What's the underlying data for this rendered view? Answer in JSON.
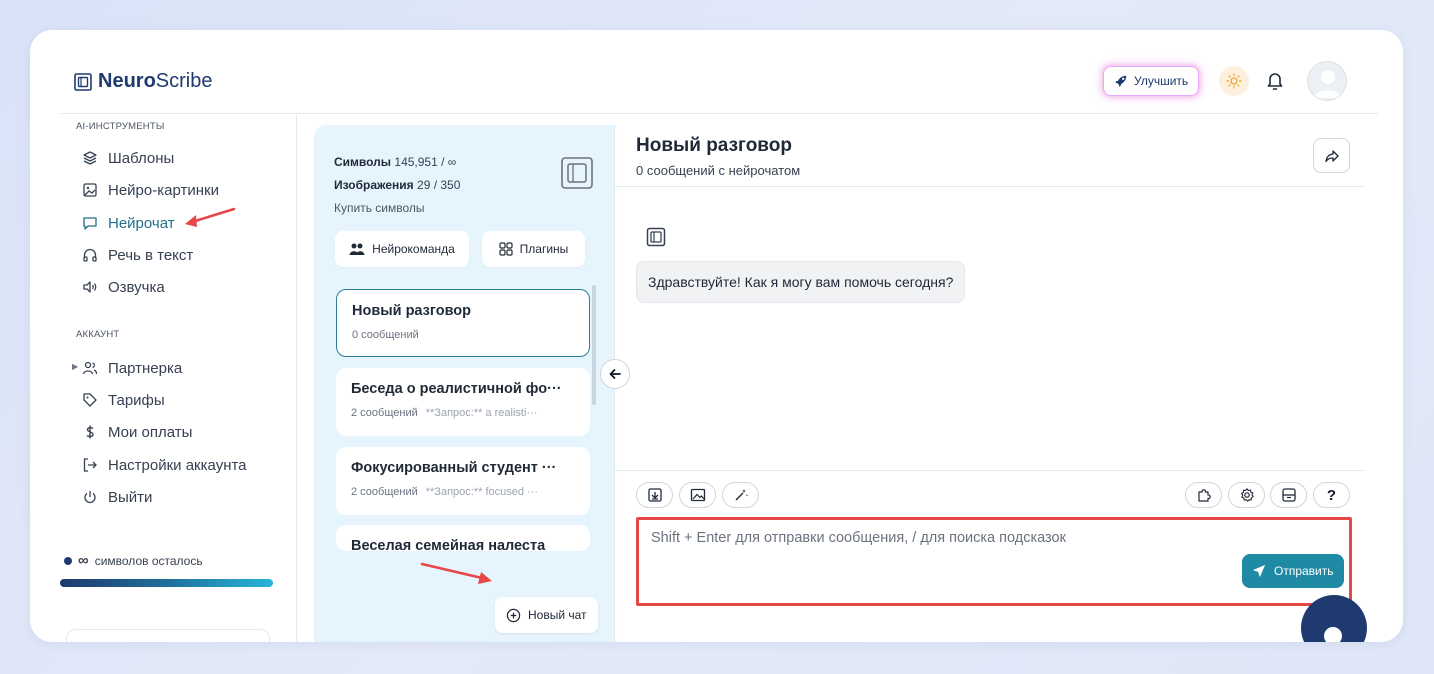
{
  "brand": {
    "name_bold": "Neuro",
    "name_rest": "Scribe"
  },
  "header": {
    "upgrade_label": "Улучшить"
  },
  "sidebar": {
    "section_tools": "AI-ИНСТРУМЕНТЫ",
    "tools": [
      {
        "label": "Шаблоны",
        "icon": "layers-icon"
      },
      {
        "label": "Нейро-картинки",
        "icon": "image-icon"
      },
      {
        "label": "Нейрочат",
        "icon": "chat-icon",
        "active": true
      },
      {
        "label": "Речь в текст",
        "icon": "headphones-icon"
      },
      {
        "label": "Озвучка",
        "icon": "speaker-icon"
      }
    ],
    "section_account": "АККАУНТ",
    "account": [
      {
        "label": "Партнерка",
        "icon": "users-icon"
      },
      {
        "label": "Тарифы",
        "icon": "tag-icon"
      },
      {
        "label": "Мои оплаты",
        "icon": "dollar-icon"
      },
      {
        "label": "Настройки аккаунта",
        "icon": "login-icon"
      },
      {
        "label": "Выйти",
        "icon": "power-icon"
      }
    ],
    "credits_symbol": "∞",
    "credits_text": "символов осталось"
  },
  "chats_panel": {
    "symbols_label": "Символы",
    "symbols_value": "145,951 / ∞",
    "images_label": "Изображения",
    "images_value": "29 / 350",
    "buy_label": "Купить символы",
    "team_button": "Нейрокоманда",
    "plugins_button": "Плагины",
    "chats": [
      {
        "title": "Новый разговор",
        "meta": "0 сообщений",
        "snippet": ""
      },
      {
        "title": "Беседа о реалистичной фо···",
        "meta": "2 сообщений",
        "snippet": "**Запрос:** a realisti···"
      },
      {
        "title": "Фокусированный студент ···",
        "meta": "2 сообщений",
        "snippet": "**Запрос:** focused ···"
      },
      {
        "title": "Веселая семейная налеста",
        "meta": "",
        "snippet": ""
      }
    ],
    "new_chat_button": "Новый чат"
  },
  "chat": {
    "title": "Новый разговор",
    "subtitle": "0 сообщений с нейрочатом",
    "greeting": "Здравствуйте! Как я могу вам помочь сегодня?",
    "input_placeholder": "Shift + Enter для отправки сообщения, / для поиска подсказок",
    "send_label": "Отправить",
    "help_label": "?"
  },
  "colors": {
    "accent": "#1f8aa3",
    "brand_dark": "#1e3a6e",
    "annotation_red": "#e64848",
    "panel_bg": "#e6f5fd"
  }
}
